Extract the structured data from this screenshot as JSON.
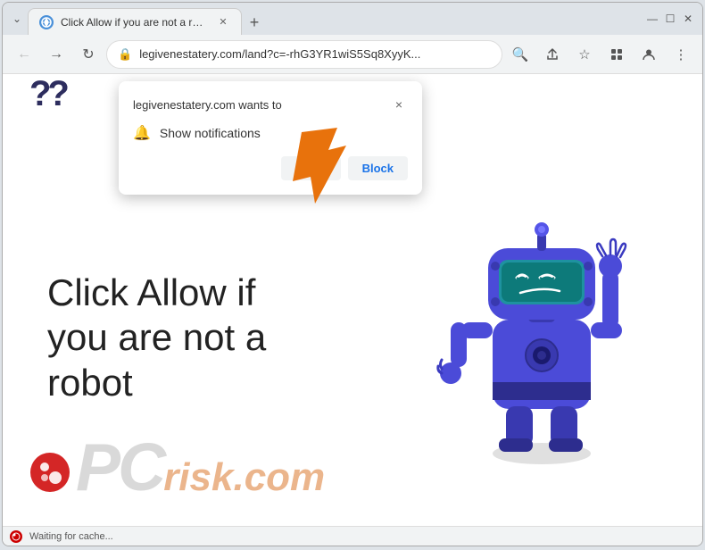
{
  "browser": {
    "tab": {
      "title": "Click Allow if you are not a robot",
      "favicon": "🌐"
    },
    "new_tab_label": "+",
    "window_controls": {
      "minimize": "—",
      "maximize": "☐",
      "close": "✕",
      "chevron": "⌄"
    },
    "nav": {
      "back": "←",
      "forward": "→",
      "reload": "↻"
    },
    "address_bar": {
      "lock": "🔒",
      "url": "legivenestatery.com/land?c=-rhG3YR1wiS5Sq8XyyK...",
      "search": "🔍",
      "share": "⬆",
      "bookmark": "☆",
      "extensions": "⬜",
      "profile": "👤",
      "menu": "⋮"
    }
  },
  "notification_popup": {
    "site_text": "legivenestatery.com wants to",
    "close_btn": "×",
    "notification_label": "Show notifications",
    "bell": "🔔",
    "allow_btn": "Allow",
    "block_btn": "Block"
  },
  "page": {
    "main_message": "Click Allow if you are not a robot",
    "question_marks": "??",
    "watermark_pc": "PC",
    "watermark_risk": "risk.com"
  },
  "status_bar": {
    "text": "Waiting for cache..."
  }
}
